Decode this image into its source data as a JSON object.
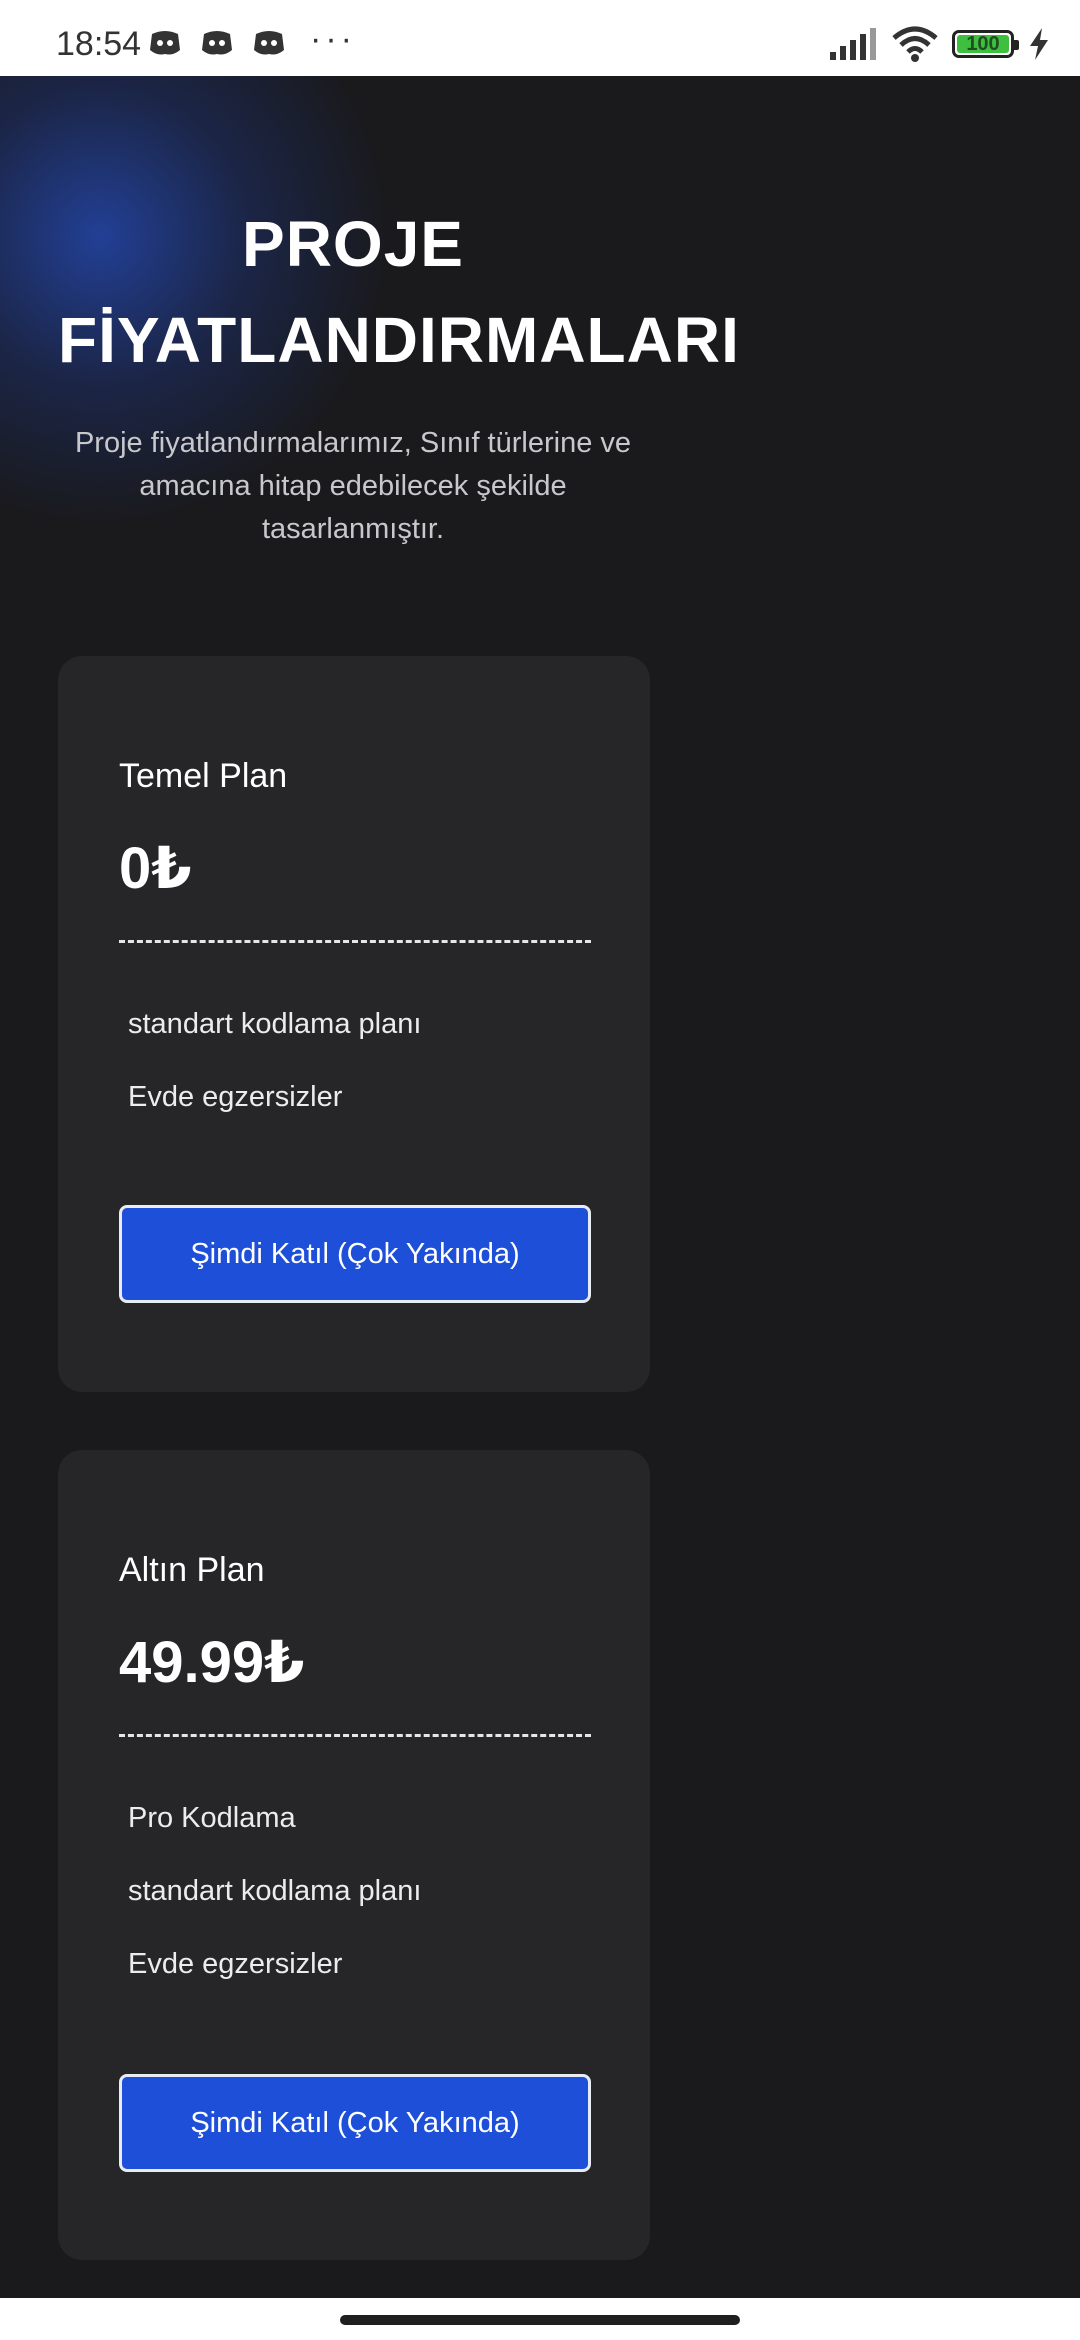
{
  "status_bar": {
    "time": "18:54",
    "notification_icons": [
      "discord-icon",
      "discord-icon",
      "discord-icon"
    ],
    "more": "···",
    "battery_level": "100",
    "battery_color": "#3fbf3f",
    "right_icons": [
      "signal-icon",
      "wifi-icon",
      "battery-icon",
      "charging-icon"
    ]
  },
  "hero": {
    "title": "PROJE FİYATLANDIRMALARI",
    "subtitle": "Proje fiyatlandırmalarımız, Sınıf türlerine ve amacına hitap edebilecek şekilde tasarlanmıştır."
  },
  "plans": [
    {
      "name": "Temel Plan",
      "price": "0₺",
      "features": [
        "standart kodlama planı",
        "Evde egzersizler"
      ],
      "button_label": "Şimdi Katıl (Çok Yakında)"
    },
    {
      "name": "Altın Plan",
      "price": "49.99₺",
      "features": [
        "Pro Kodlama",
        "standart kodlama planı",
        "Evde egzersizler"
      ],
      "button_label": "Şimdi Katıl (Çok Yakında)"
    }
  ],
  "colors": {
    "background": "#1a1a1d",
    "card": "#262629",
    "accent_button": "#1e4fd8",
    "glow": "#2346aa"
  }
}
